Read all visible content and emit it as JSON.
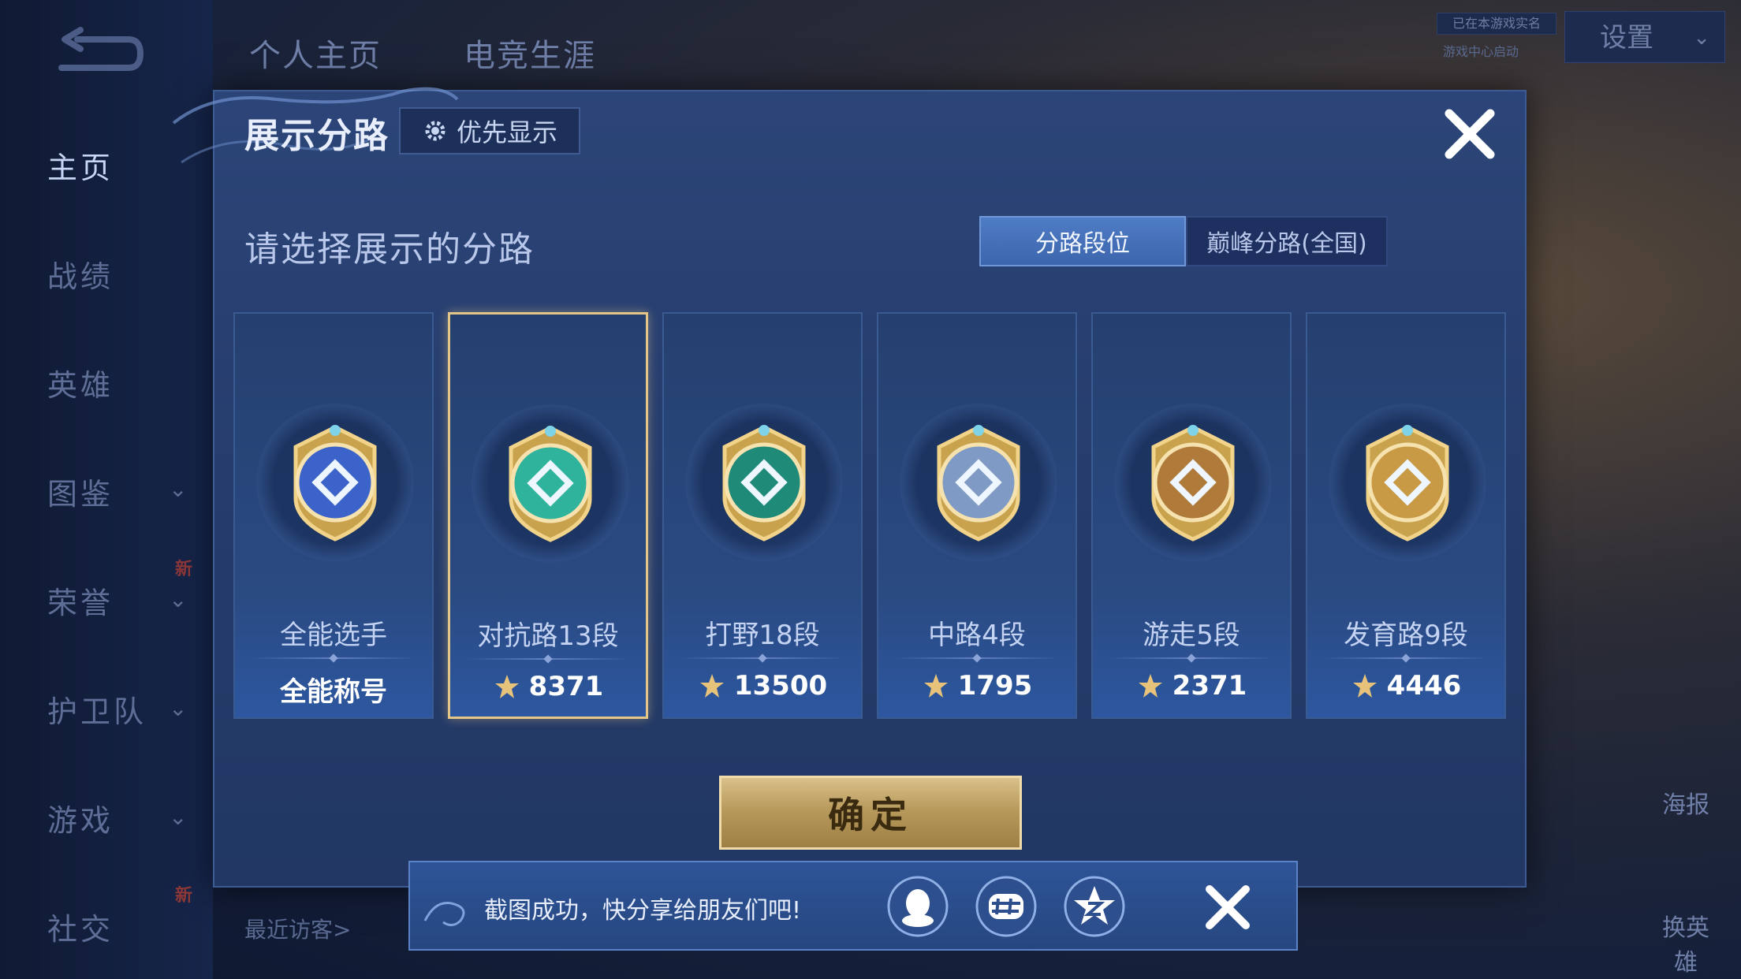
{
  "nav": {
    "top_tabs": [
      "个人主页",
      "电竞生涯"
    ],
    "items": [
      "主页",
      "战绩",
      "英雄",
      "图鉴",
      "荣誉",
      "护卫队",
      "游戏",
      "社交"
    ],
    "new_badge": "新"
  },
  "top_right": {
    "small_label": "已在本游戏实名",
    "small_label2": "游戏中心启动",
    "settings_label": "设置"
  },
  "right_sidebar": {
    "poster_label": "海报",
    "change_hero_label": "换英雄"
  },
  "recent_visitors": "最近访客>",
  "dialog": {
    "title": "展示分路",
    "priority_label": "优先显示",
    "subtitle": "请选择展示的分路",
    "segments": [
      {
        "label": "分路段位",
        "active": true
      },
      {
        "label": "巅峰分路(全国)",
        "active": false
      }
    ],
    "cards": [
      {
        "name": "全能选手",
        "value": "全能称号",
        "has_points_icon": false,
        "selected": false,
        "badge_color": "#3b63c9"
      },
      {
        "name": "对抗路13段",
        "value": "8371",
        "has_points_icon": true,
        "selected": true,
        "badge_color": "#2fb39c"
      },
      {
        "name": "打野18段",
        "value": "13500",
        "has_points_icon": true,
        "selected": false,
        "badge_color": "#1f8a78"
      },
      {
        "name": "中路4段",
        "value": "1795",
        "has_points_icon": true,
        "selected": false,
        "badge_color": "#7f9ac4"
      },
      {
        "name": "游走5段",
        "value": "2371",
        "has_points_icon": true,
        "selected": false,
        "badge_color": "#b07b3a"
      },
      {
        "name": "发育路9段",
        "value": "4446",
        "has_points_icon": true,
        "selected": false,
        "badge_color": "#c99a45"
      }
    ],
    "confirm_label": "确定"
  },
  "toast": {
    "message": "截图成功，快分享给朋友们吧!",
    "share_targets": [
      "qq-icon",
      "wechat-icon",
      "qzone-icon"
    ]
  },
  "colors": {
    "accent_gold": "#e2c587",
    "dialog_bg": "#2c4578",
    "segment_active": "#4f7cc6"
  }
}
